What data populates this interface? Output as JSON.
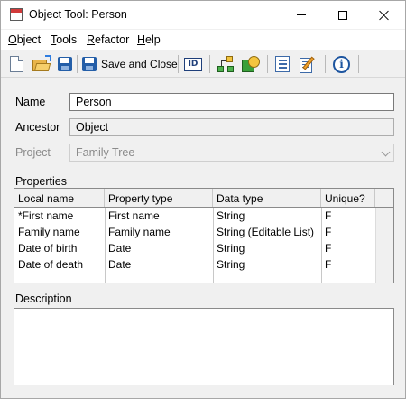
{
  "window": {
    "title": "Object Tool: Person",
    "controls": {
      "minimize": "minimize",
      "maximize": "maximize",
      "close": "close"
    }
  },
  "menu": {
    "items": [
      {
        "label": "Object",
        "mnemonic": "O",
        "rest": "bject"
      },
      {
        "label": "Tools",
        "mnemonic": "T",
        "rest": "ools"
      },
      {
        "label": "Refactor",
        "mnemonic": "R",
        "rest": "efactor"
      },
      {
        "label": "Help",
        "mnemonic": "H",
        "rest": "elp"
      }
    ]
  },
  "toolbar": {
    "save_close_label": "Save and Close",
    "id_label": "ID",
    "info_label": "i",
    "icons": [
      "new-document-icon",
      "open-folder-icon",
      "save-icon",
      "save-and-close-icon",
      "id-icon",
      "graph-icon",
      "shapes-icon",
      "form-icon",
      "edit-icon",
      "info-icon"
    ]
  },
  "form": {
    "name_label": "Name",
    "name_value": "Person",
    "ancestor_label": "Ancestor",
    "ancestor_value": "Object",
    "project_label": "Project",
    "project_value": "Family Tree"
  },
  "properties": {
    "section_label": "Properties",
    "columns": [
      "Local name",
      "Property type",
      "Data type",
      "Unique?"
    ],
    "rows": [
      [
        "*First name",
        "First name",
        "String",
        "F"
      ],
      [
        "Family name",
        "Family name",
        "String (Editable List)",
        "F"
      ],
      [
        "Date of birth",
        "Date",
        "String",
        "F"
      ],
      [
        "Date of death",
        "Date",
        "String",
        "F"
      ]
    ]
  },
  "description": {
    "section_label": "Description",
    "value": ""
  }
}
